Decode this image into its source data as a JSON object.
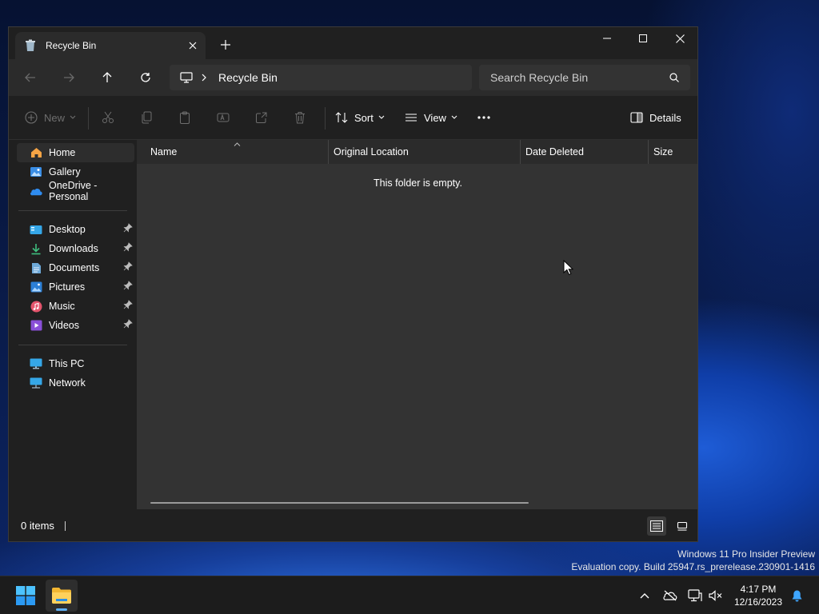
{
  "window": {
    "tab_title": "Recycle Bin",
    "address_path": "Recycle Bin",
    "search_placeholder": "Search Recycle Bin"
  },
  "commandbar": {
    "new_label": "New",
    "sort_label": "Sort",
    "view_label": "View",
    "details_label": "Details"
  },
  "sidebar": {
    "items": [
      {
        "label": "Home",
        "icon": "home-icon"
      },
      {
        "label": "Gallery",
        "icon": "gallery-icon"
      },
      {
        "label": "OneDrive - Personal",
        "icon": "onedrive-icon"
      },
      {
        "label": "Desktop",
        "icon": "desktop-icon"
      },
      {
        "label": "Downloads",
        "icon": "downloads-icon"
      },
      {
        "label": "Documents",
        "icon": "documents-icon"
      },
      {
        "label": "Pictures",
        "icon": "pictures-icon"
      },
      {
        "label": "Music",
        "icon": "music-icon"
      },
      {
        "label": "Videos",
        "icon": "videos-icon"
      },
      {
        "label": "This PC",
        "icon": "this-pc-icon"
      },
      {
        "label": "Network",
        "icon": "network-icon"
      }
    ]
  },
  "columns": [
    "Name",
    "Original Location",
    "Date Deleted",
    "Size"
  ],
  "content": {
    "empty_message": "This folder is empty."
  },
  "status": {
    "item_count": "0 items"
  },
  "watermark": {
    "line1": "Windows 11 Pro Insider Preview",
    "line2": "Evaluation copy. Build 25947.rs_prerelease.230901-1416"
  },
  "taskbar": {
    "time": "4:17 PM",
    "date": "12/16/2023"
  },
  "colors": {
    "accent": "#5fb0f5",
    "window_bg": "#202020",
    "content_bg": "#333333"
  }
}
